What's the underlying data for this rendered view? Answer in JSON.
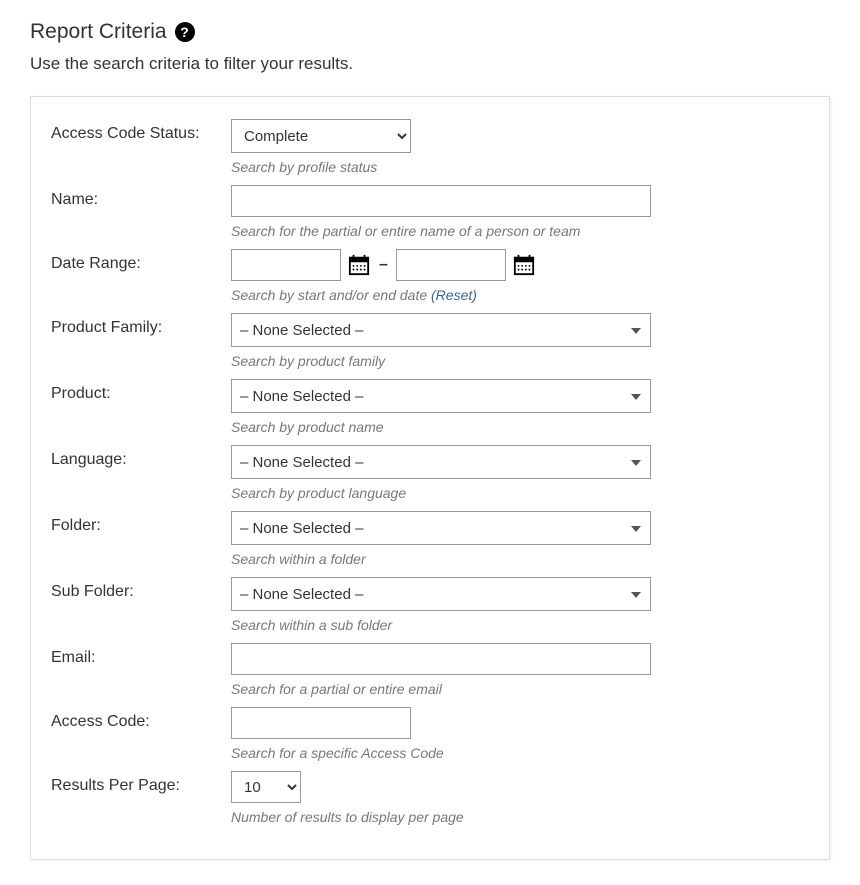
{
  "header": {
    "title": "Report Criteria",
    "subtitle": "Use the search criteria to filter your results."
  },
  "fields": {
    "access_code_status": {
      "label": "Access Code Status:",
      "value": "Complete",
      "hint": "Search by profile status"
    },
    "name": {
      "label": "Name:",
      "value": "",
      "hint": "Search for the partial or entire name of a person or team"
    },
    "date_range": {
      "label": "Date Range:",
      "start": "",
      "end": "",
      "hint": "Search by start and/or end date  ",
      "reset_label": "(Reset)"
    },
    "product_family": {
      "label": "Product Family:",
      "value": "– None Selected –",
      "hint": "Search by product family"
    },
    "product": {
      "label": "Product:",
      "value": "– None Selected –",
      "hint": "Search by product name"
    },
    "language": {
      "label": "Language:",
      "value": "– None Selected –",
      "hint": "Search by product language"
    },
    "folder": {
      "label": "Folder:",
      "value": "– None Selected –",
      "hint": "Search within a folder"
    },
    "sub_folder": {
      "label": "Sub Folder:",
      "value": "– None Selected –",
      "hint": "Search within a sub folder"
    },
    "email": {
      "label": "Email:",
      "value": "",
      "hint": "Search for a partial or entire email"
    },
    "access_code": {
      "label": "Access Code:",
      "value": "",
      "hint": "Search for a specific Access Code"
    },
    "results_per_page": {
      "label": "Results Per Page:",
      "value": "10",
      "hint": "Number of results to display per page"
    }
  }
}
